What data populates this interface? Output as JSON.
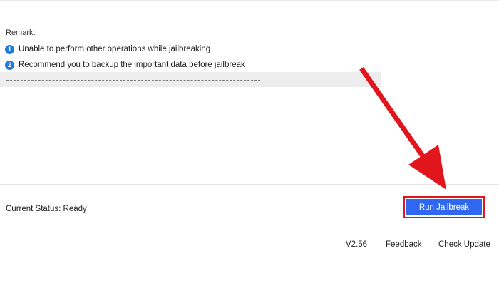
{
  "remark": {
    "label": "Remark:",
    "notes": [
      {
        "number": "1",
        "text": "Unable to perform other operations while jailbreaking"
      },
      {
        "number": "2",
        "text": "Recommend you to backup the important data before jailbreak"
      }
    ]
  },
  "status": {
    "text": "Current Status: Ready"
  },
  "actions": {
    "run_label": "Run Jailbreak"
  },
  "footer": {
    "version": "V2.56",
    "feedback": "Feedback",
    "check_update": "Check Update"
  },
  "colors": {
    "badge": "#1e7bd8",
    "button": "#2f67f0",
    "highlight": "#e0161c"
  },
  "annotation": {
    "arrow_icon": "red-arrow-pointing-to-run-button"
  }
}
